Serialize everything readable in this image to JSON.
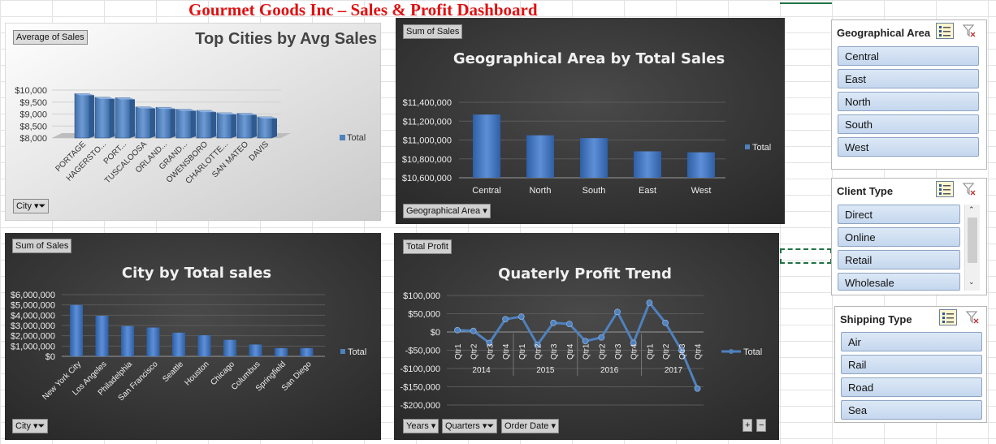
{
  "title": "Gourmet Goods Inc – Sales & Profit Dashboard",
  "pivot_buttons": {
    "c1_value": "Average of Sales",
    "c1_axis": "City",
    "c2_value": "Sum of Sales",
    "c2_axis": "Geographical Area",
    "c3_value": "Sum of Sales",
    "c3_axis": "City",
    "c4_value": "Total Profit",
    "c4_axis": [
      "Years",
      "Quarters",
      "Order Date"
    ]
  },
  "icons": {
    "dropdown": "dropdown-arrow-icon",
    "filter": "filter-funnel-icon",
    "multiselect": "multi-select-icon",
    "clear_filter": "clear-filter-icon",
    "expand": "expand-plus-icon",
    "collapse": "collapse-minus-icon"
  },
  "colors": {
    "title": "#e01010",
    "bar_blue": "#4f81bd",
    "dark_bg": "#2f2f2f",
    "slicer_button": "#c5d7ee",
    "selection": "#207245"
  },
  "chart_data": [
    {
      "type": "bar",
      "title": "Top Cities by Avg Sales",
      "categories": [
        "PORTAGE",
        "HAGERSTO...",
        "PORT...",
        "TUSCALOOSA",
        "ORLAND...",
        "GRAND...",
        "OWENSBORO",
        "CHARLOTTE...",
        "SAN MATEO",
        "DAVIS"
      ],
      "series": [
        {
          "name": "Total",
          "values": [
            9850,
            9700,
            9680,
            9300,
            9280,
            9200,
            9150,
            9050,
            9030,
            8880
          ]
        }
      ],
      "ylim": [
        8000,
        10000
      ],
      "yticks": [
        "$8,000",
        "$8,500",
        "$9,000",
        "$9,500",
        "$10,000"
      ],
      "style": "3d",
      "legend": "right"
    },
    {
      "type": "bar",
      "title": "Geographical Area by Total Sales",
      "categories": [
        "Central",
        "North",
        "South",
        "East",
        "West"
      ],
      "series": [
        {
          "name": "Total",
          "values": [
            11270000,
            11050000,
            11020000,
            10880000,
            10870000
          ]
        }
      ],
      "ylim": [
        10600000,
        11400000
      ],
      "yticks": [
        "$10,600,000",
        "$10,800,000",
        "$11,000,000",
        "$11,200,000",
        "$11,400,000"
      ],
      "legend": "right"
    },
    {
      "type": "bar",
      "title": "City by Total sales",
      "categories": [
        "New York City",
        "Los Angeles",
        "Philadelphia",
        "San Francisco",
        "Seattle",
        "Houston",
        "Chicago",
        "Columbus",
        "Springfield",
        "San Diego"
      ],
      "series": [
        {
          "name": "Total",
          "values": [
            5000000,
            3950000,
            2950000,
            2800000,
            2300000,
            2050000,
            1600000,
            1150000,
            800000,
            800000
          ]
        }
      ],
      "ylim": [
        0,
        6000000
      ],
      "yticks": [
        "$0",
        "$1,000,000",
        "$2,000,000",
        "$3,000,000",
        "$4,000,000",
        "$5,000,000",
        "$6,000,000"
      ],
      "legend": "right"
    },
    {
      "type": "line",
      "title": "Quaterly Profit Trend",
      "x": [
        "Qtr1",
        "Qtr2",
        "Qtr3",
        "Qtr4",
        "Qtr1",
        "Qtr2",
        "Qtr3",
        "Qtr4",
        "Qtr1",
        "Qtr2",
        "Qtr3",
        "Qtr4",
        "Qtr1",
        "Qtr2",
        "Qtr3",
        "Qtr4"
      ],
      "years": [
        "2014",
        "2015",
        "2016",
        "2017"
      ],
      "series": [
        {
          "name": "Total",
          "values": [
            5000,
            3000,
            -30000,
            35000,
            42000,
            -35000,
            25000,
            22000,
            -25000,
            -15000,
            55000,
            -30000,
            80000,
            25000,
            -50000,
            -155000
          ]
        }
      ],
      "ylim": [
        -200000,
        100000
      ],
      "yticks": [
        "-$200,000",
        "-$150,000",
        "-$100,000",
        "-$50,000",
        "$0",
        "$50,000",
        "$100,000"
      ],
      "legend": "right"
    }
  ],
  "slicers": {
    "geo": {
      "title": "Geographical Area",
      "items": [
        "Central",
        "East",
        "North",
        "South",
        "West"
      ]
    },
    "client": {
      "title": "Client Type",
      "items": [
        "Direct",
        "Online",
        "Retail",
        "Wholesale"
      ]
    },
    "ship": {
      "title": "Shipping Type",
      "items": [
        "Air",
        "Rail",
        "Road",
        "Sea"
      ]
    }
  }
}
